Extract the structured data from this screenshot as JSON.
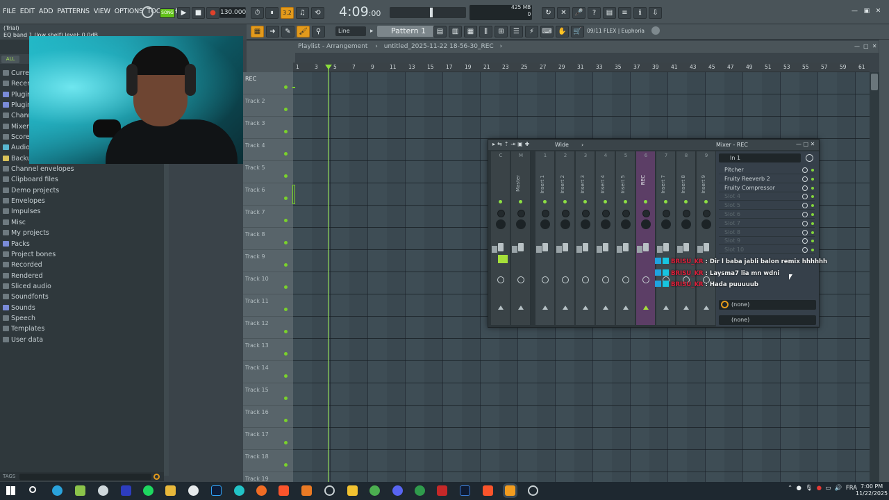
{
  "menu": [
    "FILE",
    "EDIT",
    "ADD",
    "PATTERNS",
    "VIEW",
    "OPTIONS",
    "TOOLS",
    "HELP"
  ],
  "transport": {
    "song_label": "SONG",
    "tempo": "130.000",
    "time": "4:09",
    "time_sub": ":00",
    "step_label": "3.2"
  },
  "cpu": {
    "mem": "425 MB",
    "voices": "0",
    "ram_top": "5"
  },
  "hint": {
    "line1": "(Trial)",
    "line2": "EQ band 1 (low shelf) level: 0.0dB"
  },
  "toolbar2": {
    "line_mode": "Line",
    "pattern": "Pattern 1",
    "flex": "09/11  FLEX | Euphoria"
  },
  "browser": {
    "all_label": "ALL",
    "items": [
      {
        "label": "Curren",
        "icon": "folder-icon",
        "color": "grey"
      },
      {
        "label": "Recent",
        "icon": "folder-icon",
        "color": "grey"
      },
      {
        "label": "Plugin",
        "icon": "plugin-icon",
        "color": "blue"
      },
      {
        "label": "Plugin",
        "icon": "plugin-icon",
        "color": "blue"
      },
      {
        "label": "Chann",
        "icon": "channel-icon",
        "color": "grey"
      },
      {
        "label": "Mixer",
        "icon": "mixer-icon",
        "color": "grey"
      },
      {
        "label": "Scores",
        "icon": "score-icon",
        "color": "grey"
      },
      {
        "label": "Audio",
        "icon": "audio-icon",
        "color": "cyan"
      },
      {
        "label": "Backup",
        "icon": "backup-icon",
        "color": "yellow"
      },
      {
        "label": "Channel envelopes",
        "icon": "folder-icon",
        "color": "grey"
      },
      {
        "label": "Clipboard files",
        "icon": "folder-icon",
        "color": "grey"
      },
      {
        "label": "Demo projects",
        "icon": "folder-icon",
        "color": "grey"
      },
      {
        "label": "Envelopes",
        "icon": "folder-icon",
        "color": "grey"
      },
      {
        "label": "Impulses",
        "icon": "folder-icon",
        "color": "grey"
      },
      {
        "label": "Misc",
        "icon": "folder-icon",
        "color": "grey"
      },
      {
        "label": "My projects",
        "icon": "folder-icon",
        "color": "grey"
      },
      {
        "label": "Packs",
        "icon": "packs-icon",
        "color": "blue"
      },
      {
        "label": "Project bones",
        "icon": "folder-icon",
        "color": "grey"
      },
      {
        "label": "Recorded",
        "icon": "folder-icon",
        "color": "grey"
      },
      {
        "label": "Rendered",
        "icon": "folder-icon",
        "color": "grey"
      },
      {
        "label": "Sliced audio",
        "icon": "folder-icon",
        "color": "grey"
      },
      {
        "label": "Soundfonts",
        "icon": "folder-icon",
        "color": "grey"
      },
      {
        "label": "Sounds",
        "icon": "sounds-icon",
        "color": "blue"
      },
      {
        "label": "Speech",
        "icon": "folder-icon",
        "color": "grey"
      },
      {
        "label": "Templates",
        "icon": "folder-icon",
        "color": "grey"
      },
      {
        "label": "User data",
        "icon": "folder-icon",
        "color": "grey"
      }
    ],
    "tags_label": "TAGS"
  },
  "playlist": {
    "title": "Playlist - Arrangement",
    "project": "untitled_2025-11-22 18-56-30_REC",
    "ruler": [
      "1",
      "3",
      "5",
      "7",
      "9",
      "11",
      "13",
      "15",
      "17",
      "19",
      "21",
      "23",
      "25",
      "27",
      "29",
      "31",
      "33",
      "35",
      "37",
      "39",
      "41",
      "43",
      "45",
      "47",
      "49",
      "51",
      "53",
      "55",
      "57",
      "59",
      "61"
    ],
    "tracks": [
      "REC",
      "Track 2",
      "Track 3",
      "Track 4",
      "Track 5",
      "Track 6",
      "Track 7",
      "Track 8",
      "Track 9",
      "Track 10",
      "Track 11",
      "Track 12",
      "Track 13",
      "Track 14",
      "Track 15",
      "Track 16",
      "Track 17",
      "Track 18",
      "Track 19"
    ]
  },
  "mixer": {
    "view": "Wide",
    "title": "Mixer - REC",
    "input": "In 1",
    "channels": [
      {
        "num": "C",
        "name": ""
      },
      {
        "num": "M",
        "name": "Master"
      },
      {
        "num": "1",
        "name": "Insert 1"
      },
      {
        "num": "2",
        "name": "Insert 2"
      },
      {
        "num": "3",
        "name": "Insert 3"
      },
      {
        "num": "4",
        "name": "Insert 4"
      },
      {
        "num": "5",
        "name": "Insert 5"
      },
      {
        "num": "6",
        "name": "REC"
      },
      {
        "num": "7",
        "name": "Insert 7"
      },
      {
        "num": "8",
        "name": "Insert 8"
      },
      {
        "num": "9",
        "name": "Insert 9"
      }
    ],
    "slots": [
      {
        "label": "Pitcher",
        "empty": false
      },
      {
        "label": "Fruity Reeverb 2",
        "empty": false
      },
      {
        "label": "Fruity Compressor",
        "empty": false
      },
      {
        "label": "Slot 4",
        "empty": true
      },
      {
        "label": "Slot 5",
        "empty": true
      },
      {
        "label": "Slot 6",
        "empty": true
      },
      {
        "label": "Slot 7",
        "empty": true
      },
      {
        "label": "Slot 8",
        "empty": true
      },
      {
        "label": "Slot 9",
        "empty": true
      },
      {
        "label": "Slot 10",
        "empty": true
      }
    ],
    "eq_none_1": "(none)",
    "eq_none_2": "(none)"
  },
  "chat": [
    {
      "user": "BRISU_KR",
      "msg": "Dir l baba jabli balon remix hhhhhh"
    },
    {
      "user": "BRISU_KR",
      "msg": "Laysma7 lia mn wdni"
    },
    {
      "user": "BRISU_KR",
      "msg": "Hada puuuuub"
    }
  ],
  "taskbar": {
    "lang": "FRA",
    "time": "7:00 PM",
    "date": "11/22/2025"
  }
}
